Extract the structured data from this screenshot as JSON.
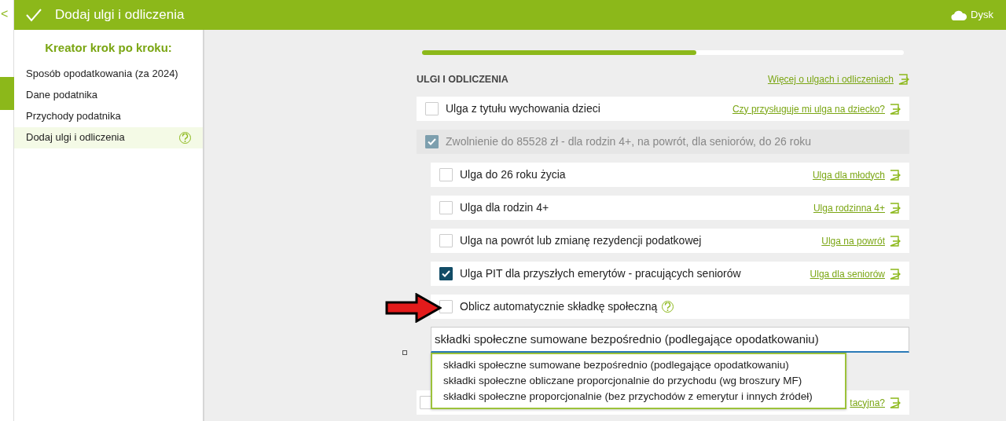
{
  "header": {
    "back": "<",
    "title": "Dodaj ulgi i odliczenia",
    "drive": "Dysk"
  },
  "sidebar": {
    "title": "Kreator krok po kroku:",
    "items": [
      {
        "label": "Sposób opodatkowania (za 2024)",
        "selected": false,
        "help": false
      },
      {
        "label": "Dane podatnika",
        "selected": false,
        "help": false
      },
      {
        "label": "Przychody podatnika",
        "selected": false,
        "help": false
      },
      {
        "label": "Dodaj ulgi i odliczenia",
        "selected": true,
        "help": true
      }
    ]
  },
  "progress": {
    "level": 0.57
  },
  "section": {
    "title": "ULGI I ODLICZENIA",
    "link": "Więcej o ulgach i odliczeniach"
  },
  "reliefs": [
    {
      "label": "Ulga z tytułu wychowania dzieci",
      "checked": false,
      "disabled": false,
      "link": "Czy przysługuje mi ulga na dziecko?"
    },
    {
      "label": "Zwolnienie do 85528 zł - dla rodzin 4+, na powrót, dla seniorów, do 26 roku",
      "checked": true,
      "disabled": true,
      "children": [
        {
          "label": "Ulga do 26 roku życia",
          "checked": false,
          "disabled": false,
          "link": "Ulga dla młodych"
        },
        {
          "label": "Ulga dla rodzin 4+",
          "checked": false,
          "disabled": false,
          "link": "Ulga rodzinna 4+"
        },
        {
          "label": "Ulga na powrót lub zmianę rezydencji podatkowej",
          "checked": false,
          "disabled": false,
          "link": "Ulga na powrót"
        },
        {
          "label": "Ulga PIT dla przyszłych emerytów - pracujących seniorów",
          "checked": true,
          "disabled": false,
          "link": "Ulga dla seniorów"
        },
        {
          "label": "Oblicz automatycznie składkę społeczną",
          "checked": false,
          "disabled": false,
          "help": true
        }
      ]
    }
  ],
  "social_select": {
    "value": "składki społeczne sumowane bezpośrednio (podlegające opodatkowaniu)",
    "expanded": true,
    "options": [
      {
        "label": "składki społeczne sumowane bezpośrednio (podlegające opodatkowaniu)"
      },
      {
        "label": "składki społeczne obliczane proporcjonalnie do przychodu (wg broszury MF)"
      },
      {
        "label": "składki społeczne proporcjonalnie (bez przychodów z emerytur i innych źródeł)"
      }
    ]
  },
  "covered_row": {
    "checked": false,
    "link": "tacyjna?"
  }
}
